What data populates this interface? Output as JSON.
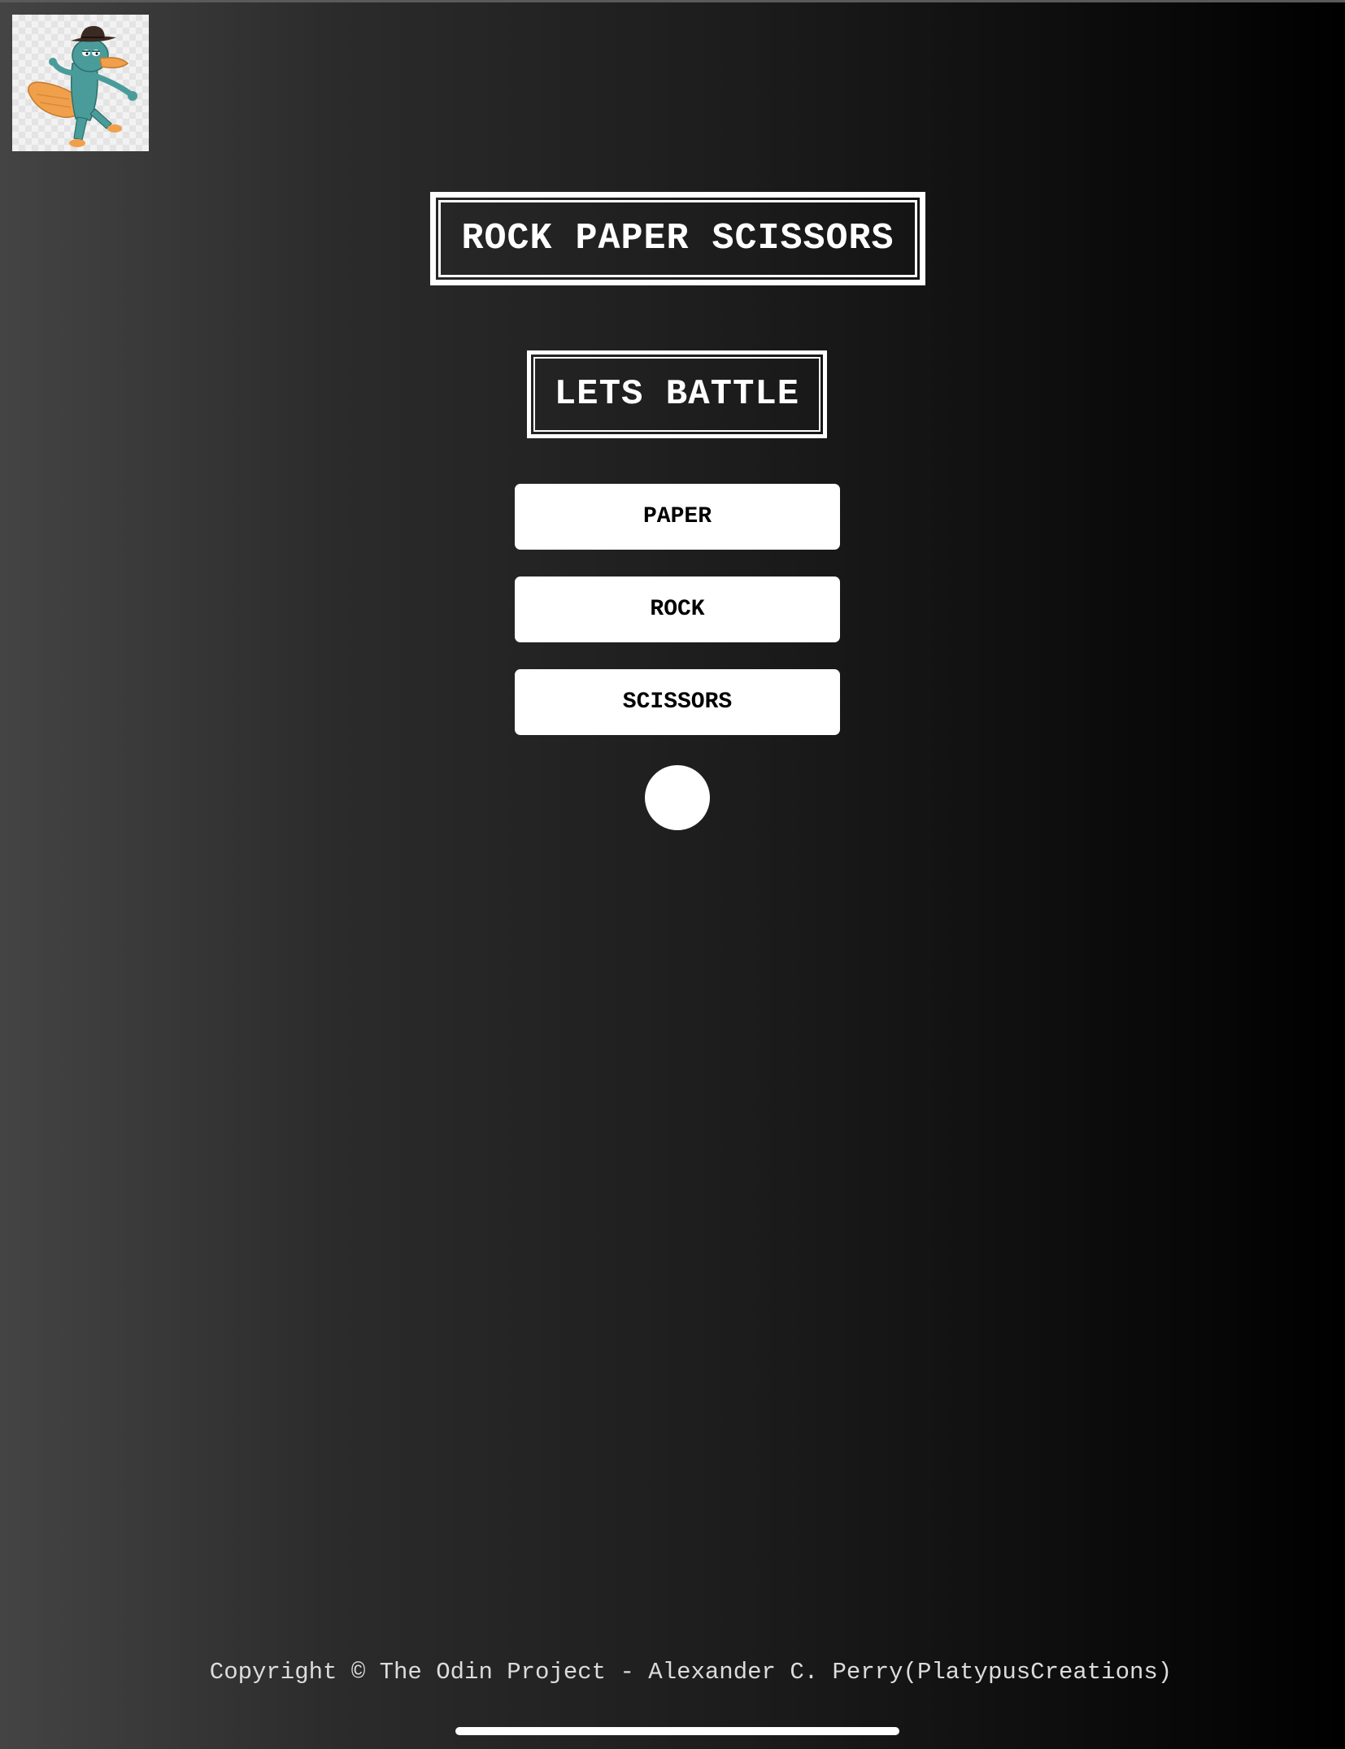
{
  "header": {
    "logo_icon": "platypus-agent-logo"
  },
  "main": {
    "title": "ROCK PAPER SCISSORS",
    "subtitle": "LETS BATTLE",
    "choices": [
      {
        "label": "PAPER"
      },
      {
        "label": "ROCK"
      },
      {
        "label": "SCISSORS"
      }
    ],
    "result_indicator_icon": "white-circle"
  },
  "footer": {
    "text": "Copyright © The Odin Project - Alexander C. Perry(PlatypusCreations)"
  },
  "colors": {
    "background_start": "#444444",
    "background_end": "#000000",
    "button_bg": "#ffffff",
    "button_text": "#000000",
    "text": "#ffffff",
    "footer_text": "#dcdcdc",
    "platypus_body": "#4a9c9a",
    "platypus_bill": "#f0a04b",
    "hat": "#3a2a22"
  }
}
